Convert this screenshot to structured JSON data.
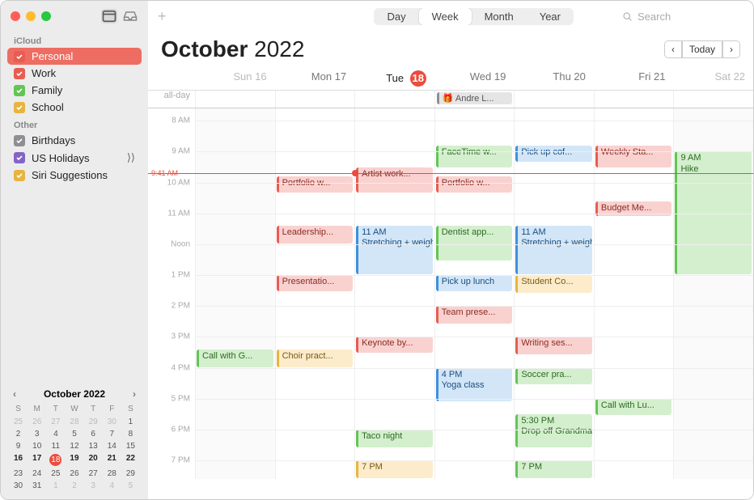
{
  "colors": {
    "red": {
      "bg": "#f9d2d0",
      "border": "#e85c51",
      "text": "#8a2c24"
    },
    "green": {
      "bg": "#d4efce",
      "border": "#62c554",
      "text": "#2d6b22"
    },
    "blue": {
      "bg": "#d2e6f7",
      "border": "#3f8fde",
      "text": "#1c4f82"
    },
    "yellow": {
      "bg": "#fceccb",
      "border": "#e7b43f",
      "text": "#7a5a14"
    },
    "purple": {
      "bg": "#e3d9f3",
      "border": "#8564c6",
      "text": "#4c2f85"
    },
    "gray": {
      "bg": "#e5e5e5",
      "border": "#8e8e93",
      "text": "#555"
    }
  },
  "sidebar": {
    "sections": [
      {
        "title": "iCloud",
        "items": [
          {
            "label": "Personal",
            "color": "red",
            "selected": true
          },
          {
            "label": "Work",
            "color": "red"
          },
          {
            "label": "Family",
            "color": "green"
          },
          {
            "label": "School",
            "color": "yellow"
          }
        ]
      },
      {
        "title": "Other",
        "items": [
          {
            "label": "Birthdays",
            "color": "gray"
          },
          {
            "label": "US Holidays",
            "color": "purple",
            "broadcast": true
          },
          {
            "label": "Siri Suggestions",
            "color": "yellow"
          }
        ]
      }
    ]
  },
  "mini_cal": {
    "title": "October 2022",
    "dow": [
      "S",
      "M",
      "T",
      "W",
      "T",
      "F",
      "S"
    ],
    "weeks": [
      [
        {
          "n": 25,
          "dim": true
        },
        {
          "n": 26,
          "dim": true
        },
        {
          "n": 27,
          "dim": true
        },
        {
          "n": 28,
          "dim": true
        },
        {
          "n": 29,
          "dim": true
        },
        {
          "n": 30,
          "dim": true
        },
        {
          "n": 1
        }
      ],
      [
        {
          "n": 2
        },
        {
          "n": 3
        },
        {
          "n": 4
        },
        {
          "n": 5
        },
        {
          "n": 6
        },
        {
          "n": 7
        },
        {
          "n": 8
        }
      ],
      [
        {
          "n": 9
        },
        {
          "n": 10
        },
        {
          "n": 11
        },
        {
          "n": 12
        },
        {
          "n": 13
        },
        {
          "n": 14
        },
        {
          "n": 15
        }
      ],
      [
        {
          "n": 16,
          "bold": true
        },
        {
          "n": 17,
          "bold": true
        },
        {
          "n": 18,
          "today": true
        },
        {
          "n": 19,
          "bold": true
        },
        {
          "n": 20,
          "bold": true
        },
        {
          "n": 21,
          "bold": true
        },
        {
          "n": 22,
          "bold": true
        }
      ],
      [
        {
          "n": 23
        },
        {
          "n": 24
        },
        {
          "n": 25
        },
        {
          "n": 26
        },
        {
          "n": 27
        },
        {
          "n": 28
        },
        {
          "n": 29
        }
      ],
      [
        {
          "n": 30
        },
        {
          "n": 31
        },
        {
          "n": 1,
          "dim": true
        },
        {
          "n": 2,
          "dim": true
        },
        {
          "n": 3,
          "dim": true
        },
        {
          "n": 4,
          "dim": true
        },
        {
          "n": 5,
          "dim": true
        }
      ]
    ]
  },
  "toolbar": {
    "views": [
      "Day",
      "Week",
      "Month",
      "Year"
    ],
    "active_view": "Week",
    "search_placeholder": "Search",
    "today_label": "Today"
  },
  "header": {
    "month": "October",
    "year": "2022"
  },
  "week": {
    "days": [
      {
        "dow": "Sun",
        "num": 16,
        "weekend": true
      },
      {
        "dow": "Mon",
        "num": 17
      },
      {
        "dow": "Tue",
        "num": 18,
        "today": true
      },
      {
        "dow": "Wed",
        "num": 19
      },
      {
        "dow": "Thu",
        "num": 20
      },
      {
        "dow": "Fri",
        "num": 21
      },
      {
        "dow": "Sat",
        "num": 22,
        "weekend": true
      }
    ],
    "allday_label": "all-day",
    "start_hour": 7.6,
    "end_hour": 19.6,
    "hour_labels": [
      {
        "h": 8,
        "label": "8 AM"
      },
      {
        "h": 9,
        "label": "9 AM"
      },
      {
        "h": 10,
        "label": "10 AM"
      },
      {
        "h": 11,
        "label": "11 AM"
      },
      {
        "h": 12,
        "label": "Noon"
      },
      {
        "h": 13,
        "label": "1 PM"
      },
      {
        "h": 14,
        "label": "2 PM"
      },
      {
        "h": 15,
        "label": "3 PM"
      },
      {
        "h": 16,
        "label": "4 PM"
      },
      {
        "h": 17,
        "label": "5 PM"
      },
      {
        "h": 18,
        "label": "6 PM"
      },
      {
        "h": 19,
        "label": "7 PM"
      }
    ],
    "now": {
      "h": 9.683,
      "label": "9:41 AM",
      "today_index": 2
    }
  },
  "allday_events": [
    {
      "day": 3,
      "title": "Andre L...",
      "color": "gray",
      "icon": "🎁"
    }
  ],
  "events": [
    {
      "day": 0,
      "start": 15.4,
      "end": 16.0,
      "title": "Call with G...",
      "color": "green"
    },
    {
      "day": 1,
      "start": 9.8,
      "end": 10.35,
      "title": "Portfolio w...",
      "color": "red"
    },
    {
      "day": 1,
      "start": 11.4,
      "end": 12.0,
      "title": "Leadership...",
      "color": "red"
    },
    {
      "day": 1,
      "start": 13.0,
      "end": 13.55,
      "title": "Presentatio...",
      "color": "red"
    },
    {
      "day": 1,
      "start": 15.4,
      "end": 16.0,
      "title": "Choir pract...",
      "color": "yellow"
    },
    {
      "day": 2,
      "start": 9.5,
      "end": 10.35,
      "title": "Artist work...",
      "color": "red"
    },
    {
      "day": 2,
      "start": 11.4,
      "end": 13.0,
      "title": "Stretching + weights",
      "time": "11 AM",
      "color": "blue"
    },
    {
      "day": 2,
      "start": 15.0,
      "end": 15.55,
      "title": "Keynote by...",
      "color": "red"
    },
    {
      "day": 2,
      "start": 18.0,
      "end": 18.6,
      "title": "Taco night",
      "color": "green"
    },
    {
      "day": 2,
      "start": 19.0,
      "end": 19.6,
      "title": "",
      "time": "7 PM",
      "color": "yellow"
    },
    {
      "day": 3,
      "start": 8.8,
      "end": 9.55,
      "title": "FaceTime w...",
      "color": "green"
    },
    {
      "day": 3,
      "start": 9.8,
      "end": 10.35,
      "title": "Portfolio w...",
      "color": "red"
    },
    {
      "day": 3,
      "start": 11.4,
      "end": 12.55,
      "title": "Dentist app...",
      "color": "green"
    },
    {
      "day": 3,
      "start": 13.0,
      "end": 13.55,
      "title": "Pick up lunch",
      "color": "blue"
    },
    {
      "day": 3,
      "start": 14.0,
      "end": 14.6,
      "title": "Team prese...",
      "color": "red"
    },
    {
      "day": 3,
      "start": 16.0,
      "end": 17.1,
      "title": "Yoga class",
      "time": "4 PM",
      "color": "blue"
    },
    {
      "day": 4,
      "start": 8.8,
      "end": 9.35,
      "title": "Pick up cof...",
      "color": "blue"
    },
    {
      "day": 4,
      "start": 11.4,
      "end": 13.0,
      "title": "Stretching + weights",
      "time": "11 AM",
      "color": "blue"
    },
    {
      "day": 4,
      "start": 13.0,
      "end": 13.6,
      "title": "Student Co...",
      "color": "yellow"
    },
    {
      "day": 4,
      "start": 15.0,
      "end": 15.6,
      "title": "Writing ses...",
      "color": "red"
    },
    {
      "day": 4,
      "start": 16.0,
      "end": 16.55,
      "title": "Soccer pra...",
      "color": "green"
    },
    {
      "day": 4,
      "start": 17.5,
      "end": 18.6,
      "title": "Drop off Grandma...",
      "time": "5:30 PM",
      "color": "green"
    },
    {
      "day": 4,
      "start": 19.0,
      "end": 19.6,
      "title": "",
      "time": "7 PM",
      "color": "green"
    },
    {
      "day": 5,
      "start": 8.8,
      "end": 9.55,
      "title": "Weekly Sta...",
      "color": "red"
    },
    {
      "day": 5,
      "start": 10.6,
      "end": 11.1,
      "title": "Budget Me...",
      "color": "red"
    },
    {
      "day": 5,
      "start": 17.0,
      "end": 17.55,
      "title": "Call with Lu...",
      "color": "green"
    },
    {
      "day": 6,
      "start": 9.0,
      "end": 13.0,
      "title": "Hike",
      "time": "9 AM",
      "color": "green"
    }
  ]
}
